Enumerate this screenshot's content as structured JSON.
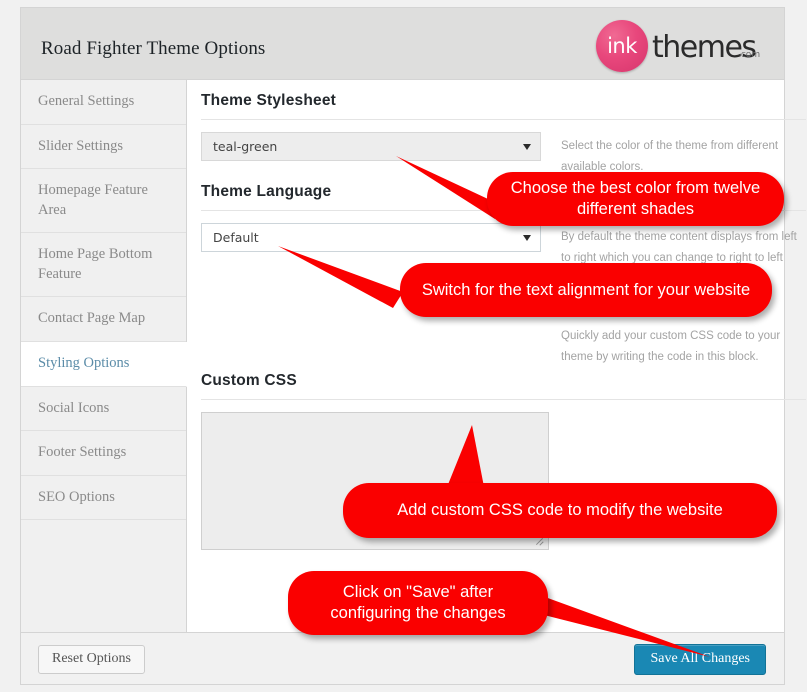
{
  "header": {
    "title": "Road Fighter Theme Options",
    "logo": {
      "mark_text": "ink",
      "word": "themes",
      "tld": ".com",
      "circle_color": "#e8477c"
    }
  },
  "sidebar": {
    "items": [
      {
        "label": "General Settings",
        "active": false
      },
      {
        "label": "Slider Settings",
        "active": false
      },
      {
        "label": "Homepage Feature Area",
        "active": false
      },
      {
        "label": "Home Page Bottom Feature",
        "active": false
      },
      {
        "label": "Contact Page Map",
        "active": false
      },
      {
        "label": "Styling Options",
        "active": true
      },
      {
        "label": "Social Icons",
        "active": false
      },
      {
        "label": "Footer Settings",
        "active": false
      },
      {
        "label": "SEO Options",
        "active": false
      }
    ]
  },
  "content": {
    "fields": [
      {
        "title": "Theme Stylesheet",
        "control": "select",
        "value": "teal-green",
        "help": "Select the color of the theme from different available colors."
      },
      {
        "title": "Theme Language",
        "control": "select",
        "value": "Default",
        "help": "By default the theme content displays from left to right which you can change to right to left"
      },
      {
        "title": "Custom CSS",
        "control": "textarea",
        "value": "",
        "placeholder": "",
        "help": "Quickly add your custom CSS code to your theme by writing the code in this block."
      }
    ]
  },
  "footer": {
    "reset_label": "Reset Options",
    "save_label": "Save All Changes",
    "save_color": "#1a88b4"
  },
  "annotations": {
    "callout_color": "#fa0000",
    "items": [
      {
        "text": "Choose the best color from twelve different shades"
      },
      {
        "text": "Switch for the text alignment for your website"
      },
      {
        "text": "Add custom CSS code to modify the website"
      },
      {
        "text": "Click on \"Save\" after configuring the changes"
      }
    ]
  }
}
